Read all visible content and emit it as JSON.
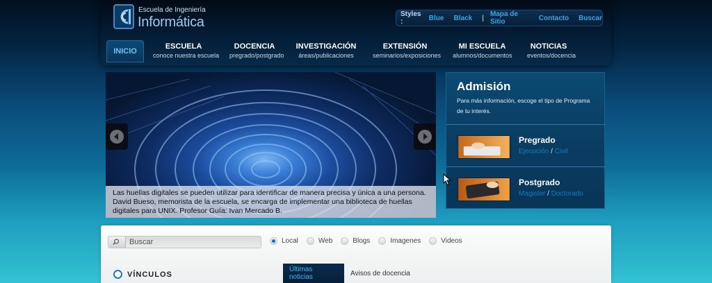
{
  "header": {
    "logo_small": "Escuela de Ingeniería",
    "logo_big": "Informática",
    "styles_label": "Styles :",
    "styles": [
      "Blue",
      "Black"
    ],
    "links": [
      "Mapa de Sitio",
      "Contacto",
      "Buscar"
    ],
    "separator": "|"
  },
  "nav": {
    "home": "INICIO",
    "items": [
      {
        "title": "ESCUELA",
        "sub": "conoce nuestra escuela"
      },
      {
        "title": "DOCENCIA",
        "sub": "pregrado/postgrado"
      },
      {
        "title": "INVESTIGACIÓN",
        "sub": "áreas/publicaciones"
      },
      {
        "title": "EXTENSIÓN",
        "sub": "seminarios/exposiciones"
      },
      {
        "title": "MI ESCUELA",
        "sub": "alumnos/documentos"
      },
      {
        "title": "NOTICIAS",
        "sub": "eventos/docencia"
      }
    ]
  },
  "slide": {
    "caption": "Las huellas digitales se pueden utilizar para identificar de manera precisa y única a una persona. David Bueso, memorista de la escuela, se encarga de implementar una biblioteca de huellas digitales para UNIX. Profesor Guía: Ivan Mercado B."
  },
  "admision": {
    "title": "Admisión",
    "desc": "Para más información, escoge el tipo de Programa de tu interés.",
    "pregrado": {
      "name": "Pregrado",
      "link1": "Ejecución",
      "sep": "/",
      "link2": "Civil"
    },
    "postgrado": {
      "name": "Postgrado",
      "link1": "Magister",
      "sep": "/",
      "link2": "Doctorado"
    }
  },
  "content": {
    "search_placeholder": "Buscar",
    "radios": [
      "Local",
      "Web",
      "Blogs",
      "Imagenes",
      "Videos"
    ],
    "selected_radio": "Local",
    "vinculos": "VÍNCULOS",
    "tabs": [
      "Últimas noticias",
      "Avisos de docencia"
    ]
  },
  "colors": {
    "accent": "#3fa4e0",
    "link": "#1b79b9"
  }
}
